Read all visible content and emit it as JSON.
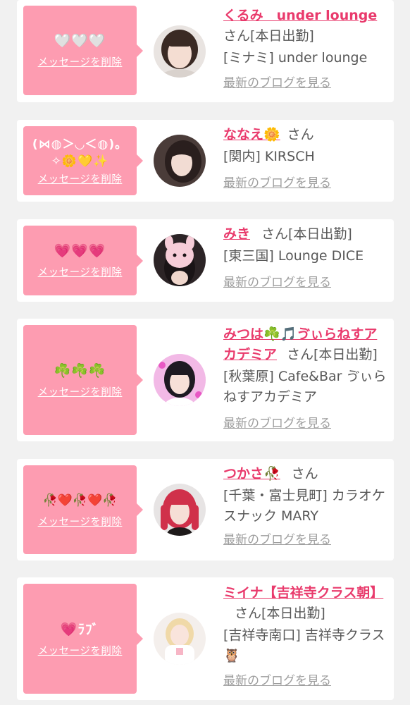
{
  "items": [
    {
      "message": "🤍🤍🤍",
      "delete_label": "メッセージを削除",
      "name": "くるみ　under lounge",
      "suffix": "さん[本日出勤]",
      "shop": "[ミナミ] under lounge",
      "blog_label": "最新のブログを見る",
      "avatar_icon": "girl-portrait-icon"
    },
    {
      "message": "(⋈◍＞◡＜◍)。✧🌼💛✨",
      "delete_label": "メッセージを削除",
      "name": "ななえ🌼",
      "suffix": "さん",
      "shop": "[関内] KIRSCH",
      "blog_label": "最新のブログを見る",
      "avatar_icon": "girl-portrait-icon"
    },
    {
      "message": "💗💗💗",
      "delete_label": "メッセージを削除",
      "name": "みき",
      "suffix": "さん[本日出勤]",
      "shop": "[東三国] Lounge DICE",
      "blog_label": "最新のブログを見る",
      "avatar_icon": "girl-portrait-icon"
    },
    {
      "message": "☘️☘️☘️",
      "delete_label": "メッセージを削除",
      "name": "みつは☘️🎵ゔぃらねすアカデミア",
      "suffix": "さん[本日出勤]",
      "shop": "[秋葉原] Cafe&Bar ゔぃらねすアカデミア",
      "blog_label": "最新のブログを見る",
      "avatar_icon": "girl-portrait-icon"
    },
    {
      "message": "🥀❤️🥀❤️🥀",
      "delete_label": "メッセージを削除",
      "name": "つかさ🥀",
      "suffix": "さん",
      "shop": "[千葉・富士見町] カラオケスナック MARY",
      "blog_label": "最新のブログを見る",
      "avatar_icon": "girl-portrait-icon"
    },
    {
      "message": "💗ﾗﾌﾞ",
      "delete_label": "メッセージを削除",
      "name": "ミイナ【吉祥寺クラス朝】",
      "suffix": "さん[本日出勤]",
      "shop": "[吉祥寺南口] 吉祥寺クラス🦉",
      "blog_label": "最新のブログを見る",
      "avatar_icon": "girl-portrait-icon"
    }
  ],
  "colors": {
    "accent": "#e93a6c",
    "bubble": "#fd9cb1",
    "page_bg": "#f1f1f1",
    "text": "#585858",
    "link_gray": "#9e9e9e"
  }
}
